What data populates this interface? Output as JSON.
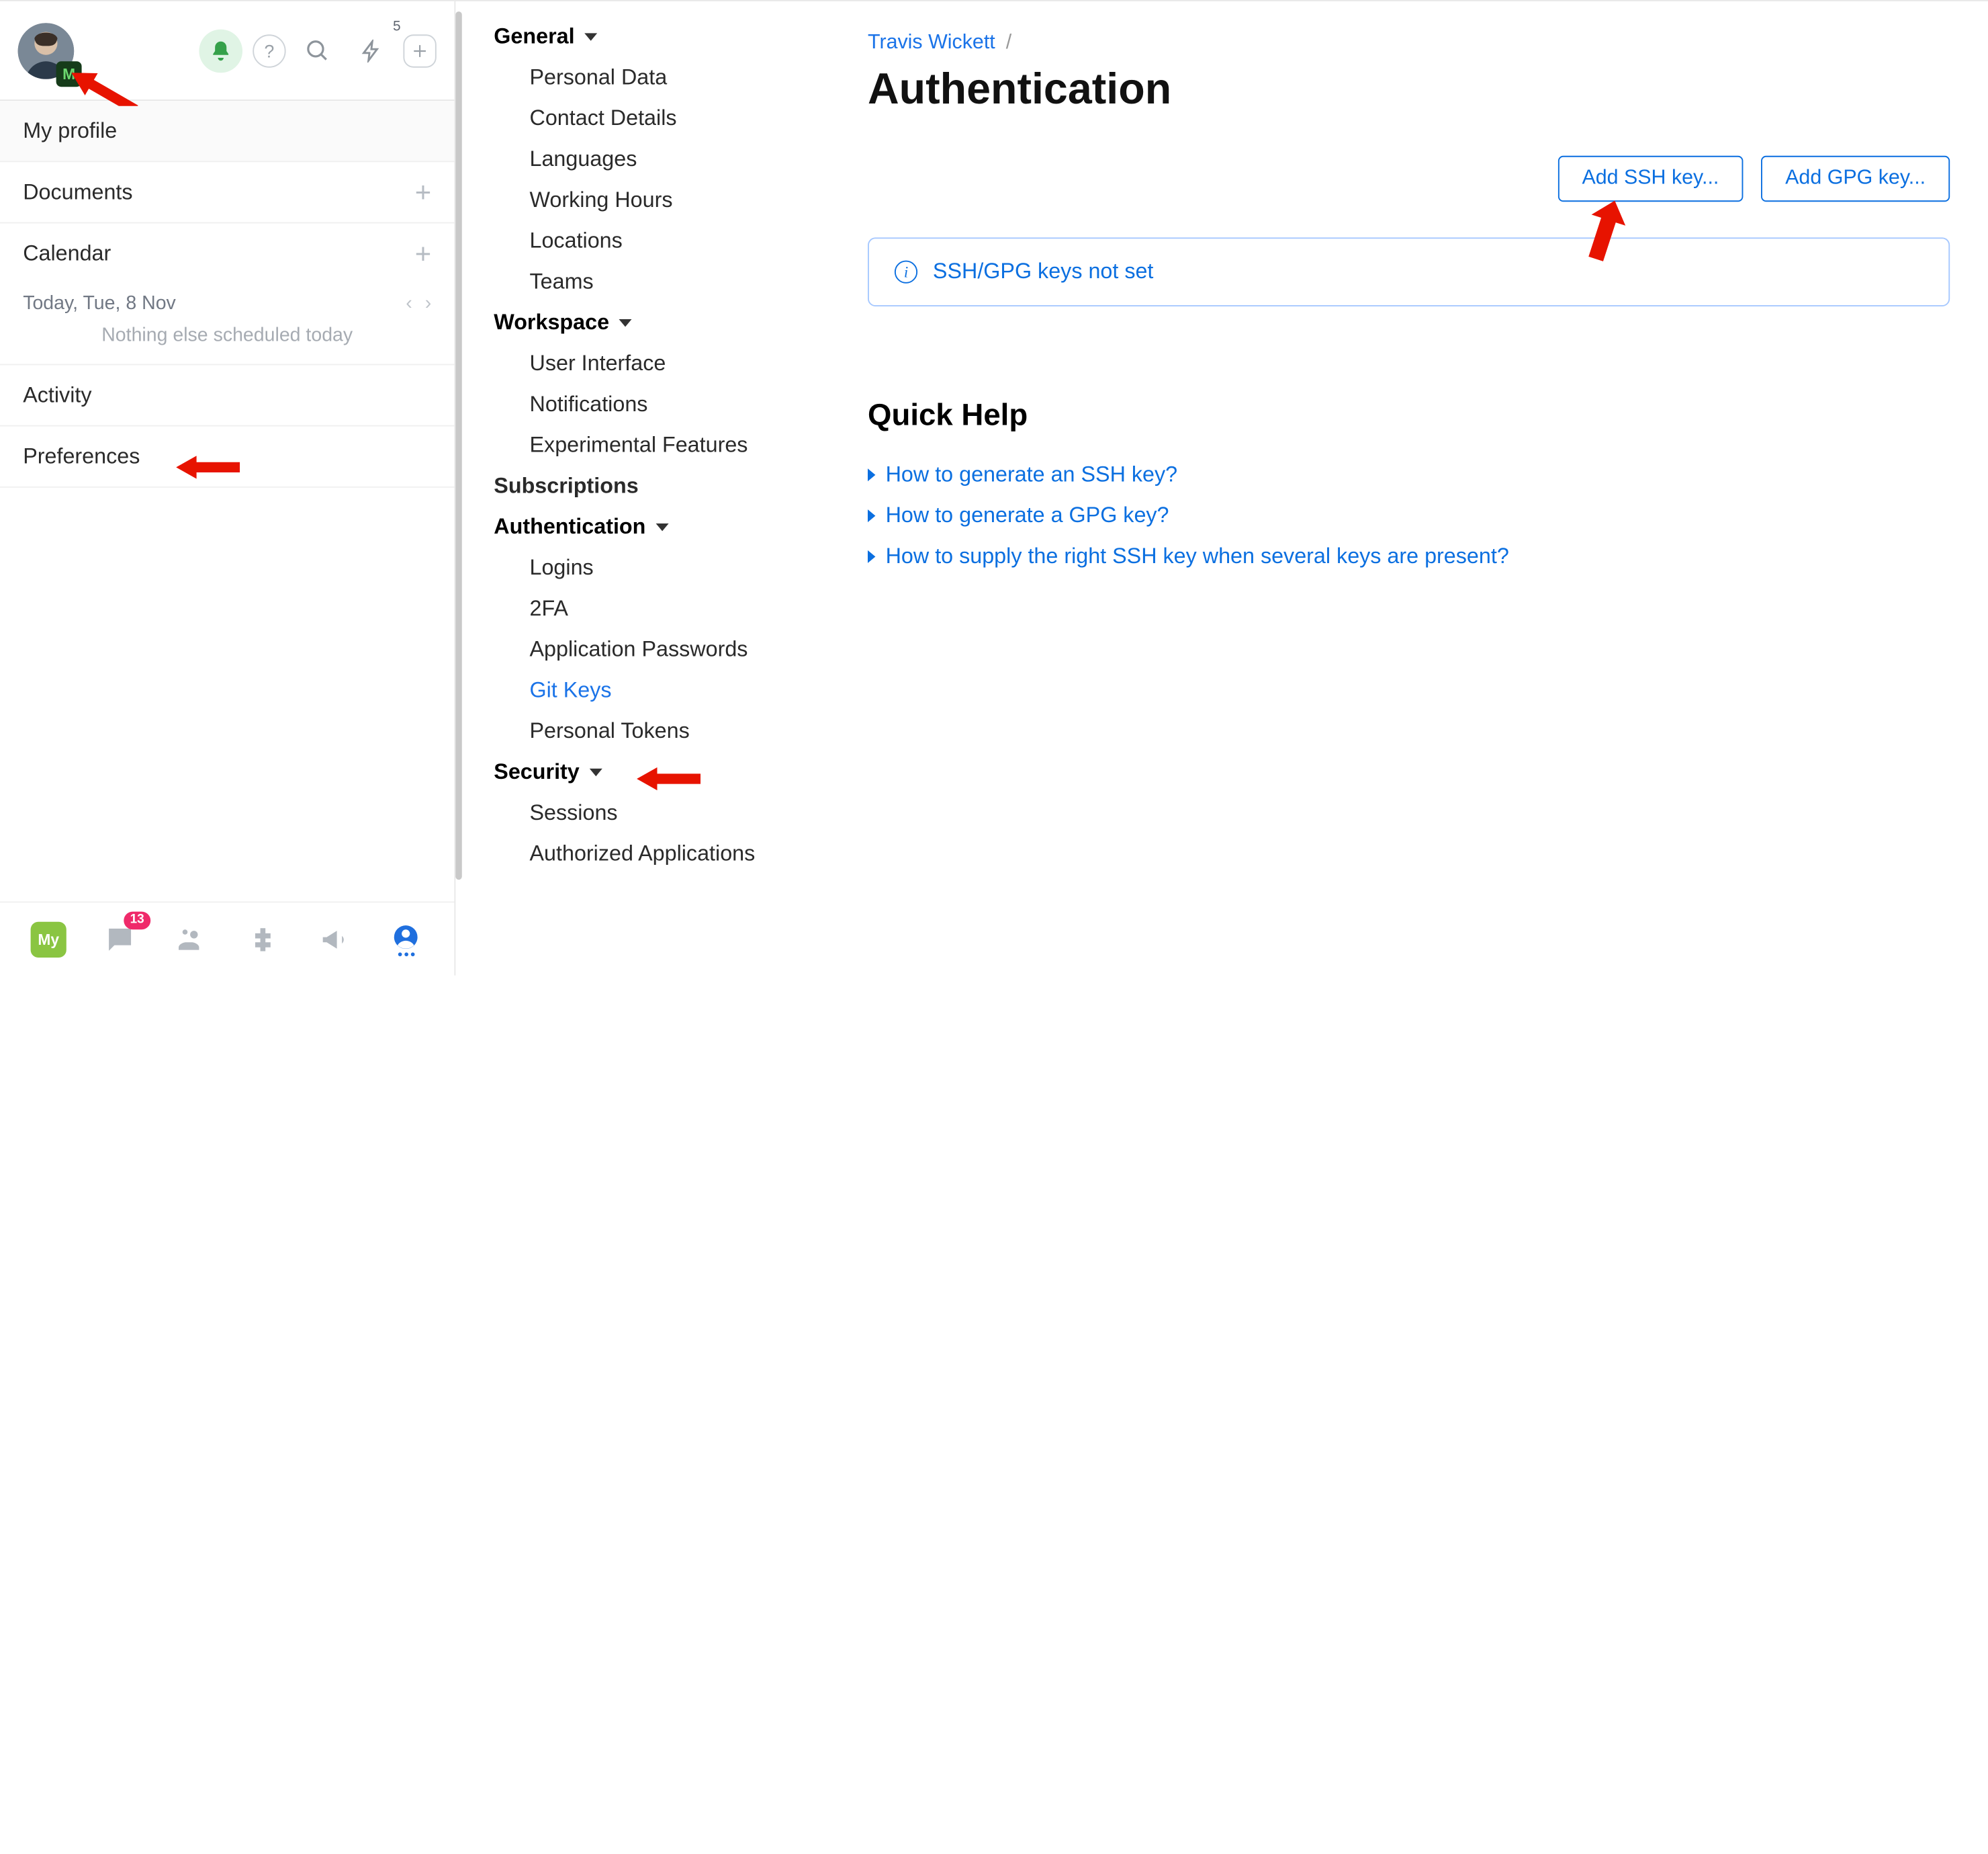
{
  "header": {
    "notifications_badge": "5",
    "chat_badge": "13",
    "my_badge": "My"
  },
  "left_nav": {
    "profile": "My profile",
    "documents": "Documents",
    "calendar": "Calendar",
    "today_label": "Today, Tue, 8 Nov",
    "empty_schedule": "Nothing else scheduled today",
    "activity": "Activity",
    "preferences": "Preferences"
  },
  "settings_nav": {
    "general": {
      "label": "General",
      "items": [
        "Personal Data",
        "Contact Details",
        "Languages",
        "Working Hours",
        "Locations",
        "Teams"
      ]
    },
    "workspace": {
      "label": "Workspace",
      "items": [
        "User Interface",
        "Notifications",
        "Experimental Features"
      ]
    },
    "subscriptions": {
      "label": "Subscriptions"
    },
    "authentication": {
      "label": "Authentication",
      "items": [
        "Logins",
        "2FA",
        "Application Passwords",
        "Git Keys",
        "Personal Tokens"
      ],
      "active": "Git Keys"
    },
    "security": {
      "label": "Security",
      "items": [
        "Sessions",
        "Authorized Applications"
      ]
    }
  },
  "breadcrumb": {
    "root": "Travis Wickett",
    "sep": "/"
  },
  "page": {
    "title": "Authentication",
    "add_ssh": "Add SSH key...",
    "add_gpg": "Add GPG key...",
    "info": "SSH/GPG keys not set",
    "quick_help_title": "Quick Help",
    "quick_help": [
      "How to generate an SSH key?",
      "How to generate a GPG key?",
      "How to supply the right SSH key when several keys are present?"
    ]
  }
}
